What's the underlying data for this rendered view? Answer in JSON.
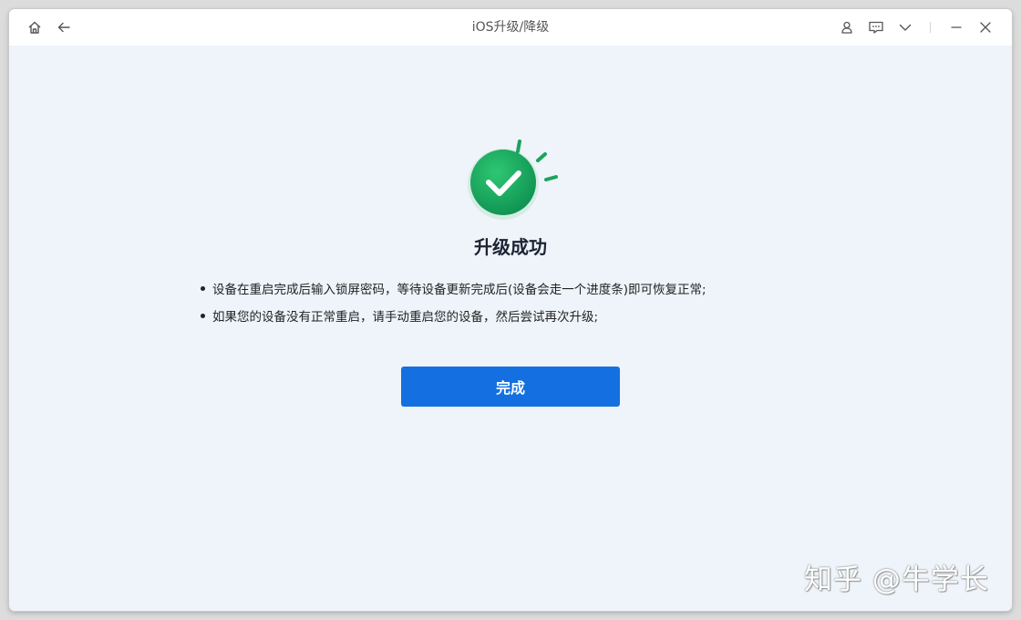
{
  "window": {
    "title": "iOS升级/降级"
  },
  "titlebar": {
    "icons": [
      "home-icon",
      "back-arrow-icon",
      "user-icon",
      "feedback-icon",
      "chevron-down-icon",
      "minimize-icon",
      "close-icon"
    ]
  },
  "main": {
    "heading": "升级成功",
    "bullets": [
      "设备在重启完成后输入锁屏密码，等待设备更新完成后(设备会走一个进度条)即可恢复正常;",
      "如果您的设备没有正常重启，请手动重启您的设备，然后尝试再次升级;"
    ],
    "done_label": "完成"
  },
  "watermark": "知乎 @牛学长",
  "colors": {
    "accent": "#1470e0",
    "success_green": "#1aa35c",
    "background": "#eef4fa"
  }
}
